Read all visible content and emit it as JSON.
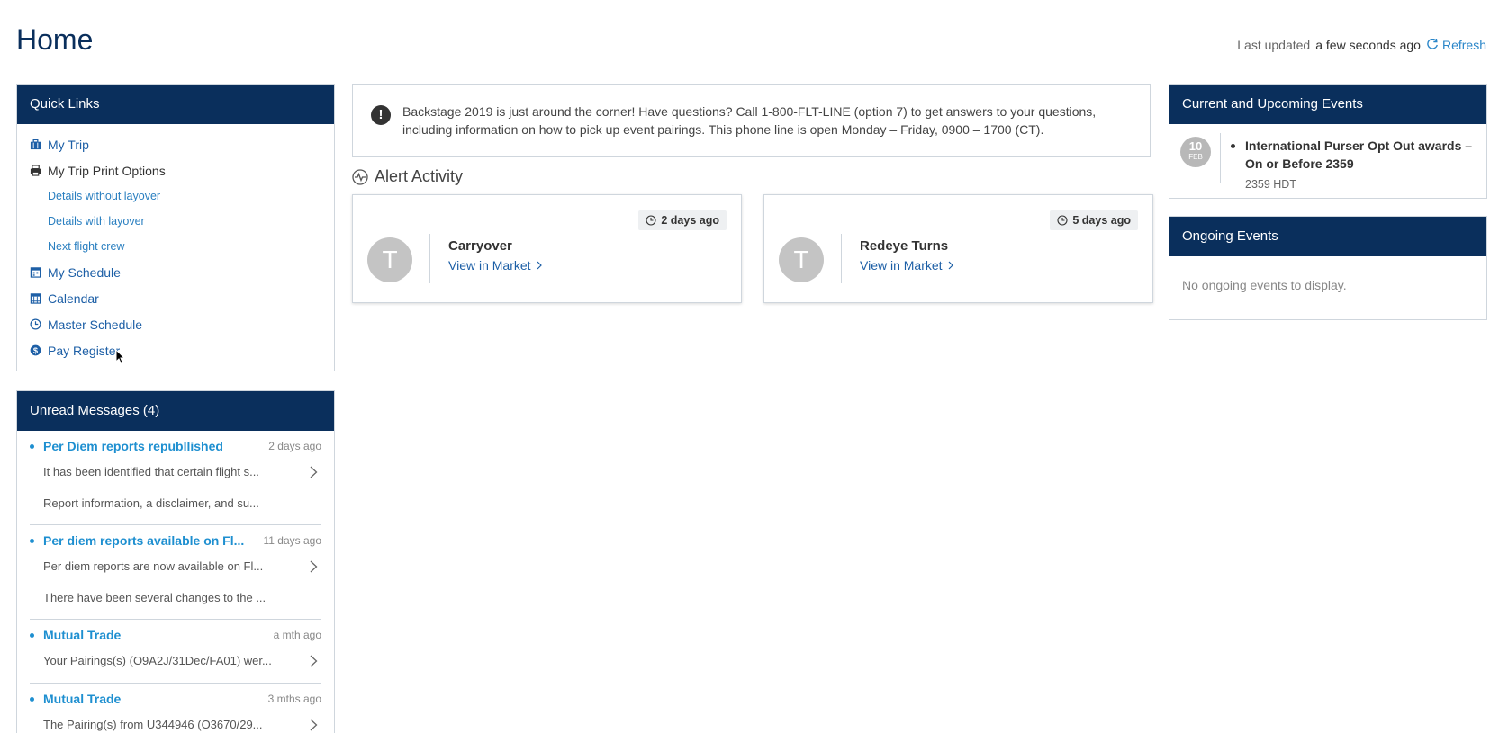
{
  "header": {
    "title": "Home",
    "last_updated_label": "Last updated",
    "last_updated_value": "a few seconds ago",
    "refresh_label": "Refresh"
  },
  "quick_links": {
    "title": "Quick Links",
    "items": [
      {
        "label": "My Trip",
        "icon": "briefcase-icon"
      },
      {
        "label": "My Trip Print Options",
        "icon": "printer-icon"
      },
      {
        "label": "Details without layover"
      },
      {
        "label": "Details with layover"
      },
      {
        "label": "Next flight crew"
      },
      {
        "label": "My Schedule",
        "icon": "schedule-icon"
      },
      {
        "label": "Calendar",
        "icon": "calendar-icon"
      },
      {
        "label": "Master Schedule",
        "icon": "clock-icon"
      },
      {
        "label": "Pay Register",
        "icon": "dollar-icon"
      }
    ]
  },
  "unread": {
    "title": "Unread Messages (4)",
    "messages": [
      {
        "title": "Per Diem reports republlished",
        "time": "2 days ago",
        "line1": "It has been identified that certain flight s...",
        "line2": "Report information, a disclaimer, and su..."
      },
      {
        "title": "Per diem reports available on Fl...",
        "time": "11 days ago",
        "line1": "Per diem reports are now available on Fl...",
        "line2": "There have been several changes to the ..."
      },
      {
        "title": "Mutual Trade",
        "time": "a mth ago",
        "line1": "Your Pairings(s) (O9A2J/31Dec/FA01) wer..."
      },
      {
        "title": "Mutual Trade",
        "time": "3 mths ago",
        "line1": "The Pairing(s) from U344946 (O3670/29..."
      }
    ]
  },
  "announcement": {
    "text": "Backstage 2019 is just around the corner! Have questions? Call 1-800-FLT-LINE (option 7) to get answers to your questions, including information on how to pick up event pairings. This phone line is open Monday – Friday, 0900 – 1700 (CT)."
  },
  "alert_activity": {
    "title": "Alert Activity",
    "cards": [
      {
        "time": "2 days ago",
        "initial": "T",
        "name": "Carryover",
        "link": "View in Market"
      },
      {
        "time": "5 days ago",
        "initial": "T",
        "name": "Redeye Turns",
        "link": "View in Market"
      }
    ]
  },
  "events": {
    "title": "Current and Upcoming Events",
    "items": [
      {
        "day": "10",
        "month": "FEB",
        "title": "International Purser Opt Out awards – On or Before 2359",
        "time": "2359 HDT"
      }
    ]
  },
  "ongoing": {
    "title": "Ongoing Events",
    "empty": "No ongoing events to display."
  }
}
